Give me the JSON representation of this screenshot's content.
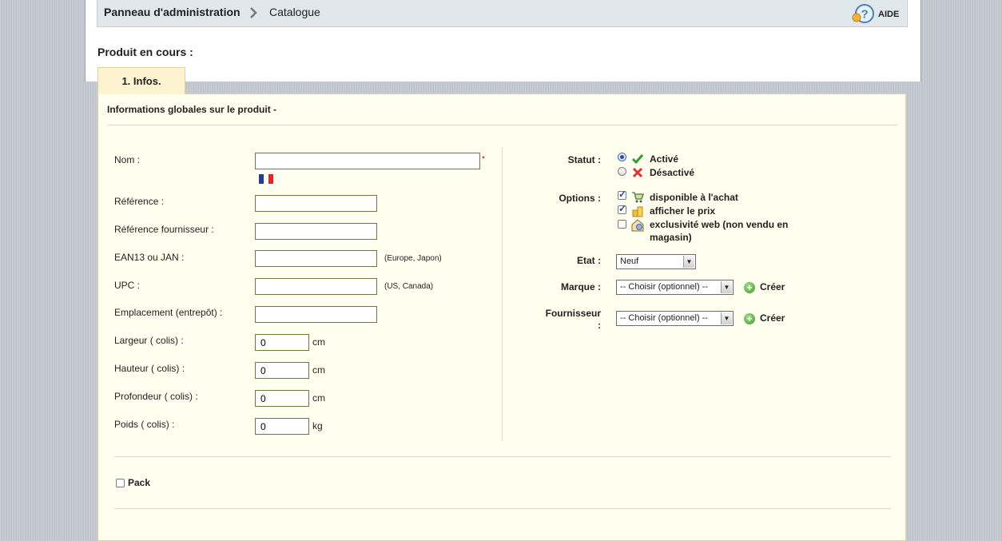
{
  "breadcrumb": {
    "admin": "Panneau d'administration",
    "catalog": "Catalogue",
    "help": "AIDE"
  },
  "product": {
    "current_label": "Produit en cours :"
  },
  "tabs": [
    {
      "label": "1. Infos."
    }
  ],
  "section": {
    "title": "Informations globales sur le produit -"
  },
  "left_fields": {
    "name_label": "Nom :",
    "name_value": "",
    "required_mark": "*",
    "reference_label": "Référence :",
    "reference_value": "",
    "supplier_ref_label": "Référence fournisseur :",
    "supplier_ref_value": "",
    "ean_label": "EAN13 ou JAN :",
    "ean_value": "",
    "ean_hint": "(Europe, Japon)",
    "upc_label": "UPC :",
    "upc_value": "",
    "upc_hint": "(US, Canada)",
    "location_label": "Emplacement (entrepôt) :",
    "location_value": "",
    "width_label": "Largeur ( colis) :",
    "width_value": "0",
    "width_unit": "cm",
    "height_label": "Hauteur ( colis) :",
    "height_value": "0",
    "height_unit": "cm",
    "depth_label": "Profondeur ( colis) :",
    "depth_value": "0",
    "depth_unit": "cm",
    "weight_label": "Poids ( colis) :",
    "weight_value": "0",
    "weight_unit": "kg"
  },
  "right_fields": {
    "status_label": "Statut :",
    "status_active": "Activé",
    "status_inactive": "Désactivé",
    "options_label": "Options :",
    "option_available": "disponible à l'achat",
    "option_show_price": "afficher le prix",
    "option_web_only_line1": "exclusivité web (non vendu en",
    "option_web_only_line2": "magasin)",
    "condition_label": "Etat :",
    "condition_value": "Neuf",
    "brand_label": "Marque :",
    "brand_value": "-- Choisir (optionnel) --",
    "brand_create": "Créer",
    "supplier_label_line1": "Fournisseur",
    "supplier_label_line2": ":",
    "supplier_value": "-- Choisir (optionnel) --",
    "supplier_create": "Créer"
  },
  "pack": {
    "label": "Pack"
  },
  "colors": {
    "tab_bg": "#fdf3d0",
    "panel_bg": "#fffff0",
    "breadcrumb_bg": "#e1e8ec",
    "page_bg": "#c3c8d0",
    "required": "#cc0000"
  }
}
